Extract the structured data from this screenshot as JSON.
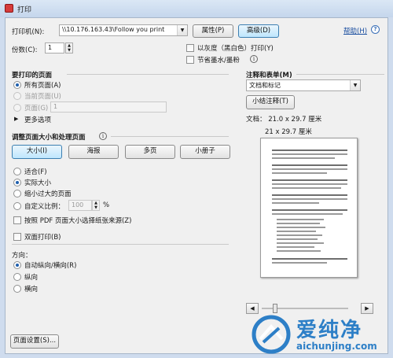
{
  "window": {
    "title": "打印"
  },
  "printer": {
    "label": "打印机(N):",
    "value": "\\\\10.176.163.43\\Follow you print",
    "properties_button": "属性(P)",
    "advanced_button": "高级(D)",
    "help_link": "帮助(H)"
  },
  "copies": {
    "label": "份数(C):",
    "value": "1"
  },
  "options": {
    "grayscale": "以灰度（黑白色）打印(Y)",
    "save_ink": "节省墨水/墨粉"
  },
  "pages_to_print": {
    "heading": "要打印的页面",
    "all": "所有页面(A)",
    "current": "当前页面(U)",
    "pages": "页面(G)",
    "pages_value": "1",
    "more": "更多选项"
  },
  "sizing": {
    "heading": "调整页面大小和处理页面",
    "buttons": [
      "大小(I)",
      "海报",
      "多页",
      "小册子"
    ],
    "fit": "适合(F)",
    "actual": "实际大小",
    "shrink": "缩小过大的页面",
    "custom": "自定义比例：",
    "custom_value": "100",
    "custom_unit": "%",
    "pdf_paper_source": "按照 PDF 页面大小选择纸张来源(Z)",
    "duplex": "双面打印(B)"
  },
  "orientation": {
    "heading": "方向：",
    "auto": "自动纵向/横向(R)",
    "portrait": "纵向",
    "landscape": "横向"
  },
  "page_setup_button": "页面设置(S)...",
  "comments": {
    "heading": "注释和表单(M)",
    "value": "文档和标记",
    "summarize_button": "小结注释(T)"
  },
  "preview": {
    "doc_size": "文档： 21.0 x 29.7 厘米",
    "page_size": "21 x 29.7 厘米"
  },
  "watermark": {
    "cn": "爱纯净",
    "url": "aichunjing.com"
  },
  "colors": {
    "accent": "#3c7fb1",
    "link": "#1b4fa0",
    "watermark": "#2d7fc7"
  }
}
